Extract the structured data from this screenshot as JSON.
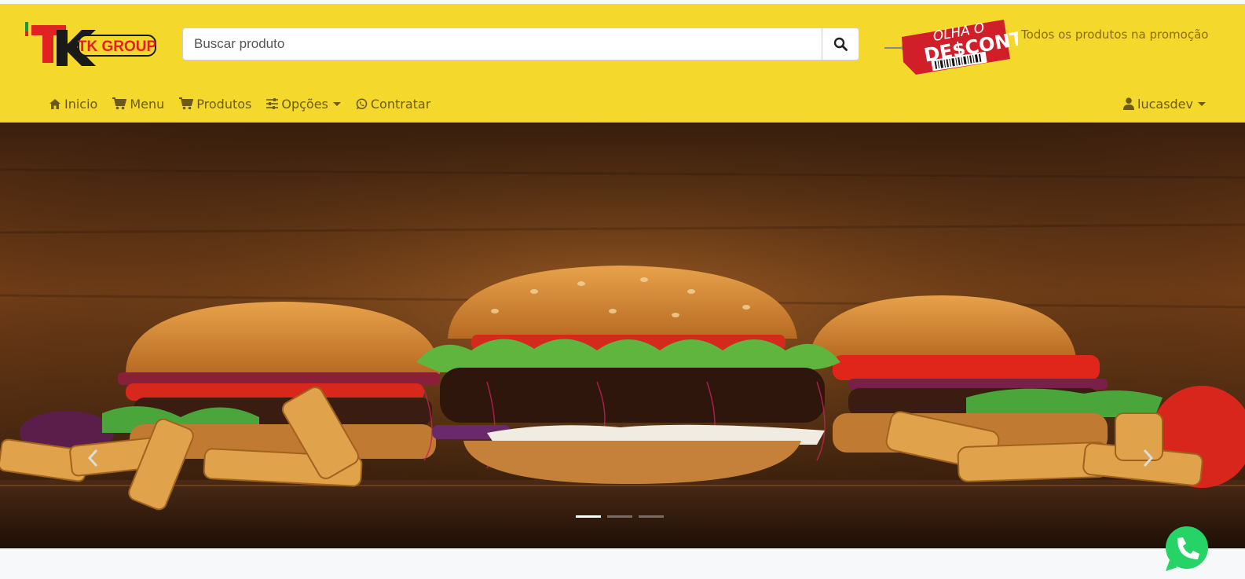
{
  "header": {
    "logo_alt": "TK GROUP",
    "search_placeholder": "Buscar produto",
    "promo_badge_line1": "OLHA O",
    "promo_badge_line2": "DE$CONTO",
    "promo_text": "Todos os produtos na promoção"
  },
  "nav": {
    "items": [
      {
        "label": "Inicio",
        "icon": "home-icon"
      },
      {
        "label": "Menu",
        "icon": "cart-icon"
      },
      {
        "label": "Produtos",
        "icon": "cart-icon"
      },
      {
        "label": "Opções",
        "icon": "sliders-icon",
        "dropdown": true
      },
      {
        "label": "Contratar",
        "icon": "whatsapp-icon"
      }
    ],
    "user": "lucasdev"
  },
  "carousel": {
    "slide_count": 3,
    "active_index": 0
  },
  "colors": {
    "header_bg": "#f5d82c",
    "nav_text": "#6b5a1a",
    "whatsapp": "#25d366"
  }
}
